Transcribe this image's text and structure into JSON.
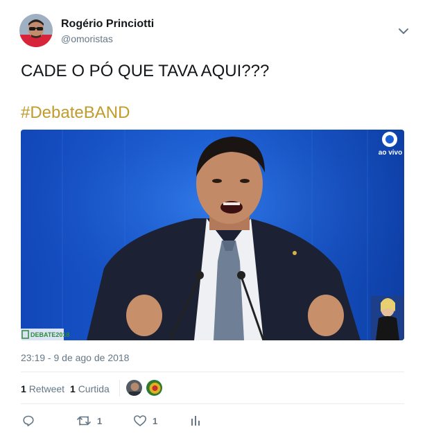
{
  "author": {
    "display_name": "Rogério Princiotti",
    "handle": "@omoristas"
  },
  "tweet": {
    "text": "CADE O PÓ QUE TAVA AQUI???",
    "hashtag": "#DebateBAND",
    "timestamp": "23:19 - 9 de ago de 2018"
  },
  "media": {
    "broadcast_badge": "ao vivo",
    "lower_third": "DEBATE2018"
  },
  "stats": {
    "retweet_count": "1",
    "retweet_label": "Retweet",
    "like_count": "1",
    "like_label": "Curtida"
  },
  "actions": {
    "reply_icon": "reply-icon",
    "retweet_icon": "retweet-icon",
    "retweet_count": "1",
    "like_icon": "heart-icon",
    "like_count": "1",
    "analytics_icon": "analytics-icon"
  },
  "colors": {
    "hashtag": "#c19b2b",
    "secondary_text": "#657786",
    "primary_text": "#14171a",
    "divider": "#e6ecf0"
  }
}
